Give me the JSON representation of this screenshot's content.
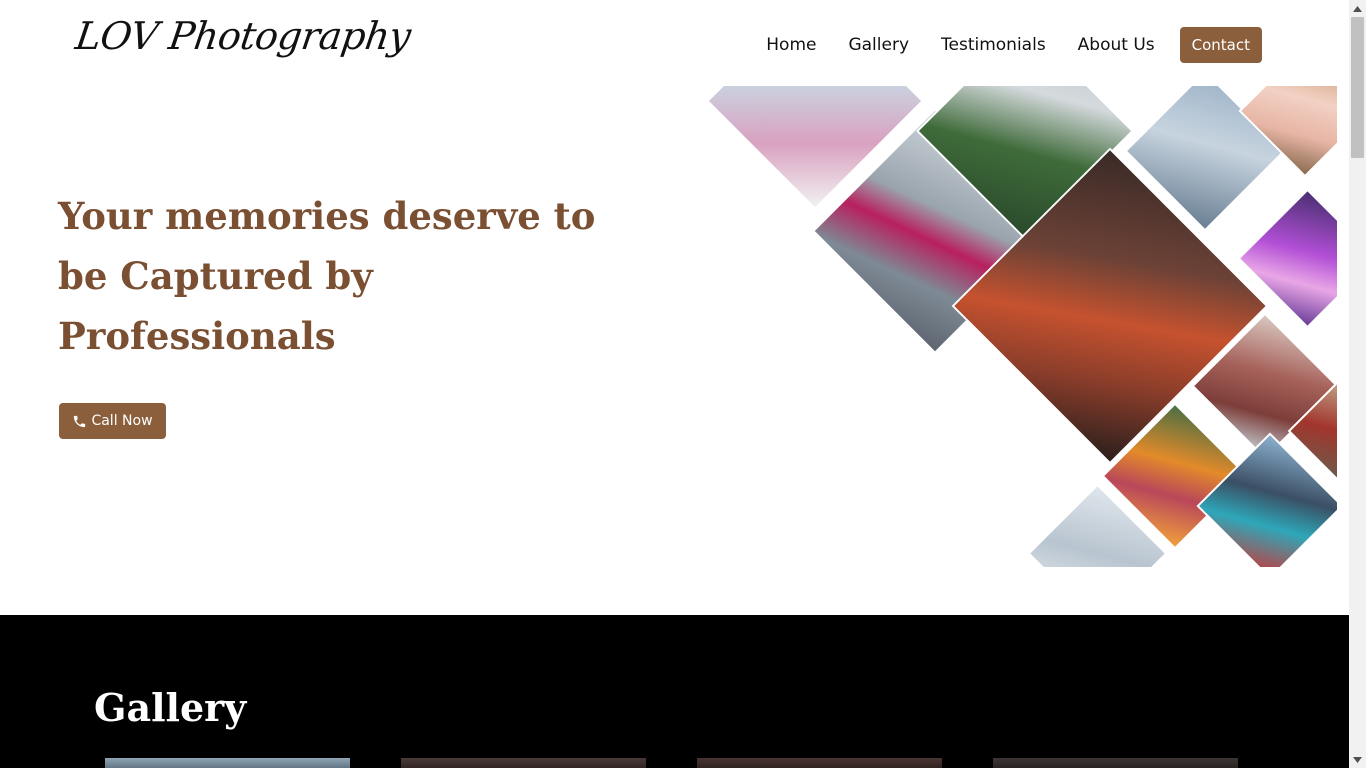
{
  "brand": {
    "logo_text": "LOV Photography",
    "accent_color": "#8b5e3c",
    "title_color": "#7a4f32"
  },
  "nav": {
    "items": [
      {
        "label": "Home"
      },
      {
        "label": "Gallery"
      },
      {
        "label": "Testimonials"
      },
      {
        "label": "About Us"
      }
    ],
    "contact_label": "Contact"
  },
  "hero": {
    "title": "Your memories deserve to be Captured by Professionals",
    "cta_label": "Call Now",
    "cta_icon": "phone-icon"
  },
  "gallery": {
    "title": "Gallery"
  }
}
